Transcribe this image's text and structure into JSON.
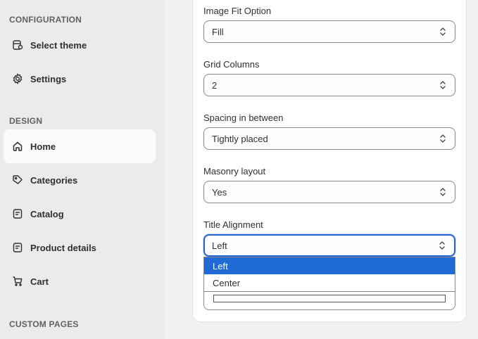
{
  "sidebar": {
    "sections": [
      {
        "heading": "CONFIGURATION"
      },
      {
        "heading": "DESIGN"
      },
      {
        "heading": "CUSTOM PAGES"
      }
    ],
    "items": [
      {
        "label": "Select theme",
        "icon": "theme-icon"
      },
      {
        "label": "Settings",
        "icon": "gear-icon"
      },
      {
        "label": "Home",
        "icon": "home-icon",
        "active": true
      },
      {
        "label": "Categories",
        "icon": "tag-icon"
      },
      {
        "label": "Catalog",
        "icon": "catalog-icon"
      },
      {
        "label": "Product details",
        "icon": "product-icon"
      },
      {
        "label": "Cart",
        "icon": "cart-icon"
      }
    ]
  },
  "form": {
    "fields": [
      {
        "label": "Image Fit Option",
        "value": "Fill"
      },
      {
        "label": "Grid Columns",
        "value": "2"
      },
      {
        "label": "Spacing in between",
        "value": "Tightly placed"
      },
      {
        "label": "Masonry layout",
        "value": "Yes"
      },
      {
        "label": "Title Alignment",
        "value": "Left"
      }
    ],
    "dropdown_options": [
      "Left",
      "Center"
    ],
    "dropdown_selected": "Left"
  },
  "colors": {
    "accent": "#2463d1",
    "option_highlight": "#1f6ad4",
    "sidebar_bg": "#ebebeb"
  }
}
